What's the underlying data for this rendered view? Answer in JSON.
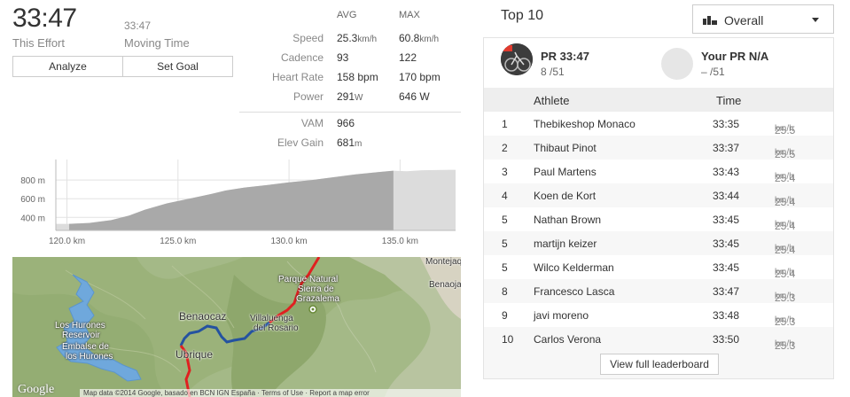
{
  "effort": {
    "time": "33:47",
    "time_label": "This Effort",
    "moving_time": "33:47",
    "moving_label": "Moving Time",
    "buttons": {
      "analyze": "Analyze",
      "set_goal": "Set Goal"
    }
  },
  "stats": {
    "avg_header": "AVG",
    "max_header": "MAX",
    "rows": [
      {
        "label": "Speed",
        "avg": "25.3",
        "avg_unit": "km/h",
        "max": "60.8",
        "max_unit": "km/h"
      },
      {
        "label": "Cadence",
        "avg": "93",
        "avg_unit": "",
        "max": "122",
        "max_unit": ""
      },
      {
        "label": "Heart Rate",
        "avg": "158 bpm",
        "avg_unit": "",
        "max": "170 bpm",
        "max_unit": ""
      },
      {
        "label": "Power",
        "avg": "291",
        "avg_unit": "W",
        "max": "646 W",
        "max_unit": ""
      },
      {
        "label": "VAM",
        "avg": "966",
        "avg_unit": "",
        "max": "",
        "max_unit": ""
      },
      {
        "label": "Elev Gain",
        "avg": "681",
        "avg_unit": "m",
        "max": "",
        "max_unit": ""
      }
    ]
  },
  "chart_data": {
    "type": "area",
    "xlabel": "",
    "ylabel": "",
    "x_ticks": [
      "120.0 km",
      "125.0 km",
      "130.0 km",
      "135.0 km"
    ],
    "x_tick_values": [
      120,
      125,
      130,
      135
    ],
    "y_ticks": [
      "800 m",
      "600 m",
      "400 m"
    ],
    "y_tick_values": [
      800,
      600,
      400
    ],
    "xlim": [
      119.5,
      137.5
    ],
    "ylim": [
      260,
      1020
    ],
    "grid": true,
    "segment_range_km": [
      120.1,
      134.7
    ],
    "profile": {
      "x": [
        119.5,
        120.1,
        121.0,
        122.0,
        122.8,
        123.5,
        124.5,
        125.5,
        126.5,
        127.2,
        128.0,
        129.0,
        130.0,
        131.0,
        132.0,
        133.0,
        134.0,
        134.7,
        135.3,
        136.0,
        137.5
      ],
      "y": [
        330,
        330,
        340,
        370,
        420,
        480,
        550,
        600,
        650,
        690,
        720,
        745,
        775,
        800,
        830,
        860,
        885,
        900,
        895,
        905,
        910
      ]
    }
  },
  "map": {
    "labels": {
      "montejaque": "Montejaq",
      "benaojan": "Benaoja",
      "ubrique": "Ubrique",
      "benaocaz": "Benaocaz",
      "villaluenga_1": "Villaluenga",
      "villaluenga_2": "del Rosario",
      "grazalema_1": "Parque Natural",
      "grazalema_2": "Sierra de",
      "grazalema_3": "Grazalema",
      "reservoir_1": "Los Hurones",
      "reservoir_2": "Reservoir",
      "reservoir_3": "Embalse de",
      "reservoir_4": "los Hurones"
    },
    "logo": "Google",
    "footer": "Map data ©2014 Google, basado en BCN IGN España · Terms of Use · Report a map error"
  },
  "top10": {
    "title": "Top 10",
    "filter": "Overall",
    "pr": {
      "title": "PR 33:47",
      "rank": "8",
      "of": "/51"
    },
    "your_pr": {
      "title": "Your PR N/A",
      "rank": "–",
      "of": "/51"
    },
    "headers": {
      "athlete": "Athlete",
      "time": "Time"
    },
    "rows": [
      {
        "rank": "1",
        "name": "Thebikeshop Monaco",
        "time": "33:35",
        "speed": "25.5",
        "unit": "km/h"
      },
      {
        "rank": "2",
        "name": "Thibaut Pinot",
        "time": "33:37",
        "speed": "25.5",
        "unit": "km/h"
      },
      {
        "rank": "3",
        "name": "Paul Martens",
        "time": "33:43",
        "speed": "25.4",
        "unit": "km/h"
      },
      {
        "rank": "4",
        "name": "Koen de Kort",
        "time": "33:44",
        "speed": "25.4",
        "unit": "km/h"
      },
      {
        "rank": "5",
        "name": "Nathan Brown",
        "time": "33:45",
        "speed": "25.4",
        "unit": "km/h"
      },
      {
        "rank": "5",
        "name": "martijn keizer",
        "time": "33:45",
        "speed": "25.4",
        "unit": "km/h"
      },
      {
        "rank": "5",
        "name": "Wilco Kelderman",
        "time": "33:45",
        "speed": "25.4",
        "unit": "km/h"
      },
      {
        "rank": "8",
        "name": "Francesco Lasca",
        "time": "33:47",
        "speed": "25.3",
        "unit": "km/h"
      },
      {
        "rank": "9",
        "name": "javi moreno",
        "time": "33:48",
        "speed": "25.3",
        "unit": "km/h"
      },
      {
        "rank": "10",
        "name": "Carlos Verona",
        "time": "33:50",
        "speed": "25.3",
        "unit": "km/h"
      }
    ],
    "full_button": "View full leaderboard"
  }
}
